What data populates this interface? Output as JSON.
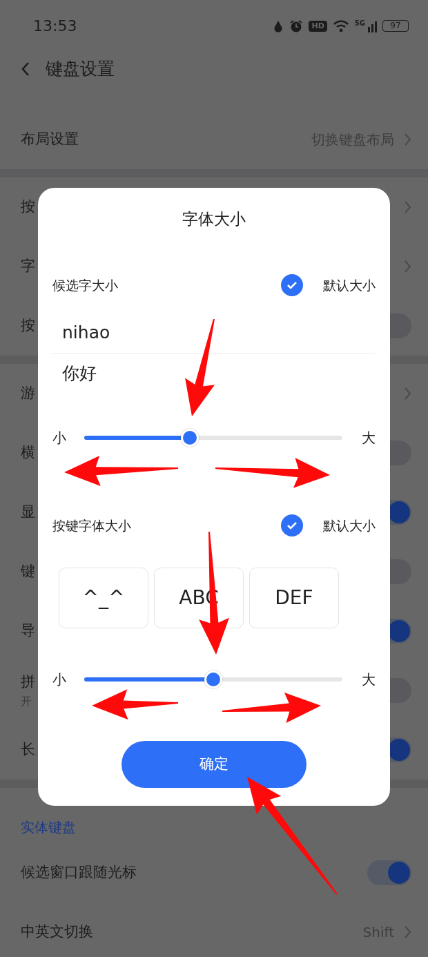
{
  "status_bar": {
    "time": "13:53",
    "hd": "HD",
    "network": "5G",
    "battery": "97"
  },
  "header": {
    "title": "键盘设置"
  },
  "groups": [
    {
      "rows": [
        {
          "kind": "link",
          "label": "布局设置",
          "value": "切换键盘布局"
        }
      ]
    },
    {
      "rows": [
        {
          "kind": "link",
          "label": "按"
        },
        {
          "kind": "link",
          "label": "字"
        },
        {
          "kind": "toggle",
          "label": "按",
          "on": false
        }
      ]
    },
    {
      "rows": [
        {
          "kind": "link",
          "label": "游"
        },
        {
          "kind": "toggle",
          "label": "横",
          "on": false
        },
        {
          "kind": "toggle",
          "label": "显",
          "on": true
        },
        {
          "kind": "toggle",
          "label": "键",
          "on": false
        },
        {
          "kind": "toggle",
          "label": "导",
          "on": true
        },
        {
          "kind": "toggle",
          "label": "拼",
          "subtitle": "开",
          "on": false
        },
        {
          "kind": "toggle",
          "label": "长",
          "on": true
        }
      ]
    },
    {
      "title": "实体键盘",
      "rows": [
        {
          "kind": "toggle",
          "label": "候选窗口跟随光标",
          "on": true
        },
        {
          "kind": "link",
          "label": "中英文切换",
          "value": "Shift"
        }
      ]
    }
  ],
  "dialog": {
    "title": "字体大小",
    "sections": [
      {
        "label": "候选字大小",
        "default_checked": true,
        "default_label": "默认大小",
        "preview": {
          "kind": "lines",
          "items": [
            "nihao",
            "你好"
          ]
        },
        "slider": {
          "min_label": "小",
          "max_label": "大",
          "level": 0.41
        }
      },
      {
        "label": "按键字体大小",
        "default_checked": true,
        "default_label": "默认大小",
        "preview": {
          "kind": "keys",
          "items": [
            "^_^",
            "ABC",
            "DEF"
          ]
        },
        "slider": {
          "min_label": "小",
          "max_label": "大",
          "level": 0.5
        }
      }
    ],
    "button": "确定"
  }
}
